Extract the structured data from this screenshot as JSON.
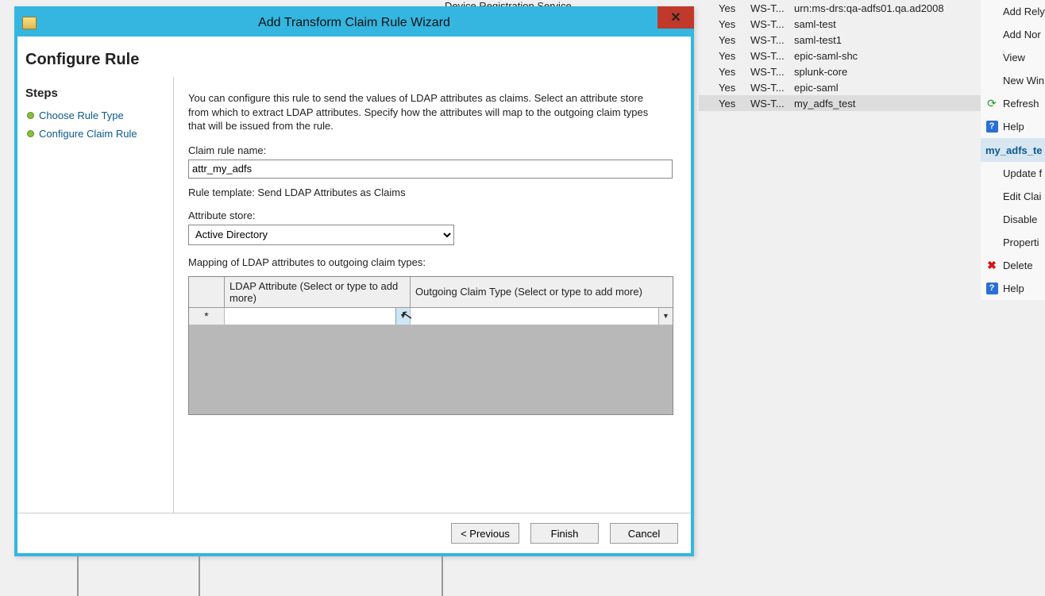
{
  "bg": {
    "topPartial": "Device Registration Service",
    "rows": [
      {
        "c1": "Yes",
        "c2": "WS-T...",
        "c3": "urn:ms-drs:qa-adfs01.qa.ad2008"
      },
      {
        "c1": "Yes",
        "c2": "WS-T...",
        "c3": "saml-test"
      },
      {
        "c1": "Yes",
        "c2": "WS-T...",
        "c3": "saml-test1"
      },
      {
        "c1": "Yes",
        "c2": "WS-T...",
        "c3": "epic-saml-shc"
      },
      {
        "c1": "Yes",
        "c2": "WS-T...",
        "c3": "splunk-core"
      },
      {
        "c1": "Yes",
        "c2": "WS-T...",
        "c3": "epic-saml"
      },
      {
        "c1": "Yes",
        "c2": "WS-T...",
        "c3": "my_adfs_test"
      }
    ],
    "menu": {
      "top": [
        "Add Rely",
        "Add Nor",
        "View",
        "New Win",
        "Refresh",
        "Help"
      ],
      "header": "my_adfs_te",
      "bottom": [
        "Update f",
        "Edit Clai",
        "Disable",
        "Properti",
        "Delete",
        "Help"
      ]
    }
  },
  "wizard": {
    "title": "Add Transform Claim Rule Wizard",
    "close": "✕",
    "heading": "Configure Rule",
    "stepsTitle": "Steps",
    "steps": [
      "Choose Rule Type",
      "Configure Claim Rule"
    ],
    "description": "You can configure this rule to send the values of LDAP attributes as claims. Select an attribute store from which to extract LDAP attributes. Specify how the attributes will map to the outgoing claim types that will be issued from the rule.",
    "ruleNameLabel": "Claim rule name:",
    "ruleNameValue": "attr_my_adfs",
    "templateLine": "Rule template: Send LDAP Attributes as Claims",
    "attrStoreLabel": "Attribute store:",
    "attrStoreValue": "Active Directory",
    "mappingLabel": "Mapping of LDAP attributes to outgoing claim types:",
    "gridHeaders": {
      "ldap": "LDAP Attribute (Select or type to add more)",
      "out": "Outgoing Claim Type (Select or type to add more)"
    },
    "rowMarker": "*",
    "buttons": {
      "prev": "< Previous",
      "finish": "Finish",
      "cancel": "Cancel"
    }
  }
}
